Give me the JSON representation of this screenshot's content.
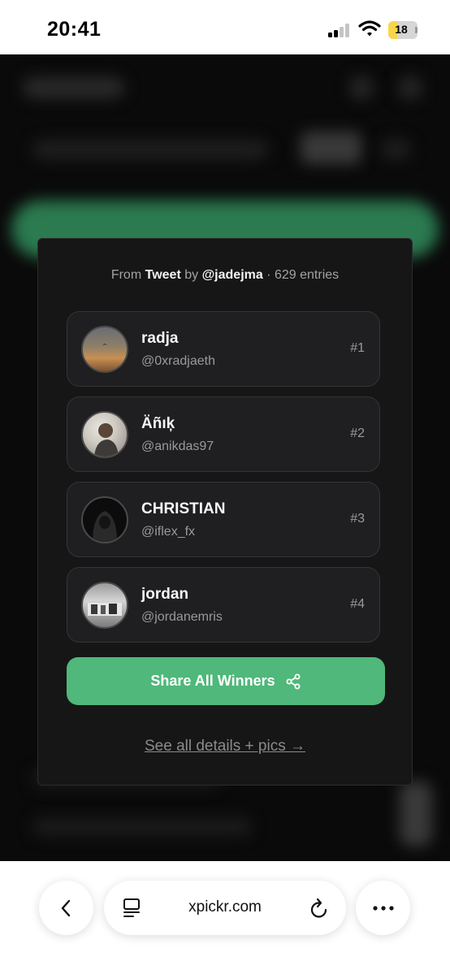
{
  "status_bar": {
    "time": "20:41",
    "battery_level": "18"
  },
  "card": {
    "header": {
      "from": "From",
      "source": "Tweet",
      "by": "by",
      "author": "@jadejma",
      "entries": "· 629 entries"
    },
    "winners": [
      {
        "name": "radja",
        "handle": "@0xradjaeth",
        "rank": "#1"
      },
      {
        "name": "Äñıķ",
        "handle": "@anikdas97",
        "rank": "#2"
      },
      {
        "name": "CHRISTIAN",
        "handle": "@iflex_fx",
        "rank": "#3"
      },
      {
        "name": "jordan",
        "handle": "@jordanemris",
        "rank": "#4"
      }
    ],
    "share_button": "Share All Winners",
    "details_link": "See all details + pics →"
  },
  "browser": {
    "url": "xpickr.com"
  },
  "colors": {
    "accent": "#4fb87a",
    "card_bg": "#161616",
    "page_bg": "#0a0a0a"
  },
  "icons": [
    "back-chevron-icon",
    "reader-icon",
    "reload-icon",
    "more-icon",
    "share-icon",
    "wifi-icon",
    "signal-icon",
    "battery-icon"
  ]
}
